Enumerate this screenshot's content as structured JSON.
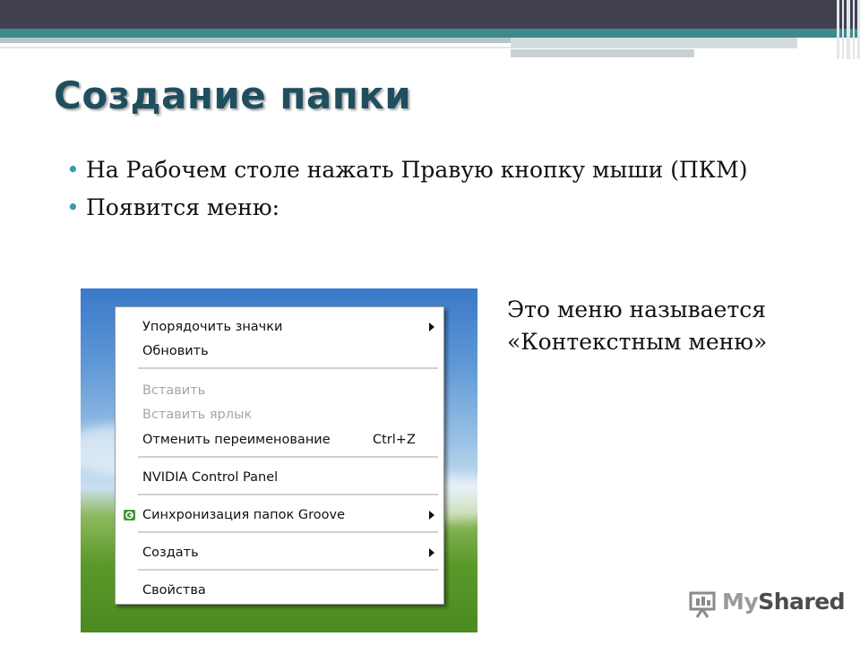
{
  "slide": {
    "title": "Создание папки",
    "bullets": [
      "На Рабочем столе нажать Правую кнопку мыши (ПКМ)",
      "Появится меню:"
    ],
    "caption": "Это меню называется «Контекстным меню»"
  },
  "context_menu": {
    "items": [
      {
        "label": "Упорядочить значки",
        "submenu": true
      },
      {
        "label": "Обновить"
      },
      {
        "label": "Вставить",
        "disabled": true
      },
      {
        "label": "Вставить ярлык",
        "disabled": true
      },
      {
        "label": "Отменить переименование",
        "shortcut": "Ctrl+Z"
      },
      {
        "label": "NVIDIA Control Panel"
      },
      {
        "label": "Синхронизация папок Groove",
        "submenu": true,
        "icon": "groove-icon"
      },
      {
        "label": "Создать",
        "submenu": true
      },
      {
        "label": "Свойства"
      }
    ]
  },
  "logo": {
    "brand_my": "My",
    "brand_shared": "Shared"
  },
  "colors": {
    "title": "#1f4f5f",
    "bullet": "#3a9ab0",
    "top_bar_dark": "#414150",
    "top_bar_teal": "#3d8a8c"
  }
}
